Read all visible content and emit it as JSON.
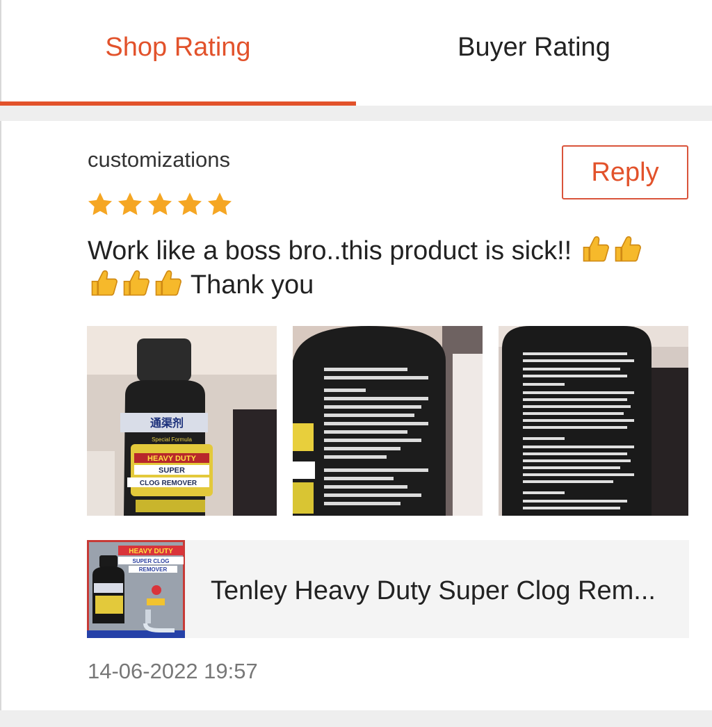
{
  "tabs": [
    {
      "label": "Shop Rating",
      "active": true
    },
    {
      "label": "Buyer Rating",
      "active": false
    }
  ],
  "review": {
    "username": "customizations",
    "rating": 5,
    "reply_label": "Reply",
    "text_part1": "Work like a boss bro..this product is sick!!",
    "text_part2": "Thank you",
    "emoji": "thumbs-up",
    "photos": [
      "review-photo-1",
      "review-photo-2",
      "review-photo-3"
    ],
    "product_name": "Tenley Heavy Duty Super Clog Rem...",
    "thumb_text": [
      "HEAVY DUTY",
      "SUPER CLOG",
      "REMOVER"
    ],
    "bottle_label": [
      "Special Formula",
      "HEAVY DUTY",
      "SUPER",
      "CLOG REMOVER"
    ],
    "timestamp": "14-06-2022 19:57"
  },
  "colors": {
    "accent": "#e2522b",
    "star": "#f5a623",
    "separator": "#eeeeee",
    "card_bg": "#f4f4f4"
  }
}
